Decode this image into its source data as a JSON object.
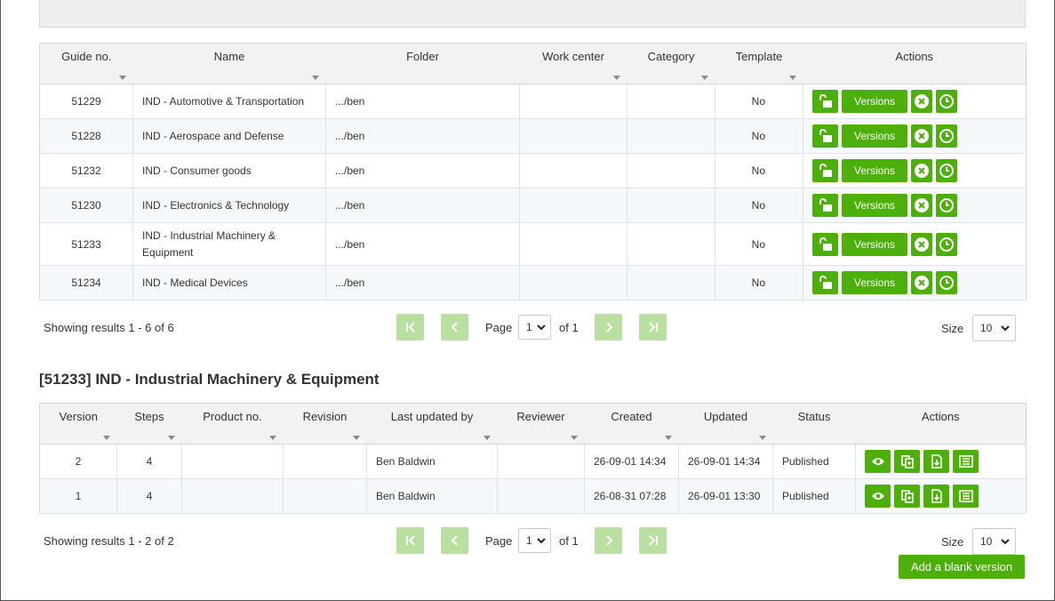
{
  "guides": {
    "columns": [
      "Guide no.",
      "Name",
      "Folder",
      "Work center",
      "Category",
      "Template",
      "Actions"
    ],
    "rows": [
      {
        "guide_no": "51229",
        "name": "IND - Automotive & Transportation",
        "folder": ".../ben",
        "work_center": "",
        "category": "",
        "template": "No"
      },
      {
        "guide_no": "51228",
        "name": "IND - Aerospace and Defense",
        "folder": ".../ben",
        "work_center": "",
        "category": "",
        "template": "No"
      },
      {
        "guide_no": "51232",
        "name": "IND - Consumer goods",
        "folder": ".../ben",
        "work_center": "",
        "category": "",
        "template": "No"
      },
      {
        "guide_no": "51230",
        "name": "IND - Electronics & Technology",
        "folder": ".../ben",
        "work_center": "",
        "category": "",
        "template": "No"
      },
      {
        "guide_no": "51233",
        "name": "IND - Industrial Machinery & Equipment",
        "folder": ".../ben",
        "work_center": "",
        "category": "",
        "template": "No"
      },
      {
        "guide_no": "51234",
        "name": "IND - Medical Devices",
        "folder": ".../ben",
        "work_center": "",
        "category": "",
        "template": "No"
      }
    ],
    "versions_label": "Versions",
    "pager": {
      "showing": "Showing results 1 - 6 of 6",
      "page_label": "Page",
      "page_value": "1",
      "of_label": "of 1",
      "size_label": "Size",
      "size_value": "10"
    }
  },
  "detail": {
    "title": "[51233] IND - Industrial Machinery & Equipment",
    "columns": [
      "Version",
      "Steps",
      "Product no.",
      "Revision",
      "Last updated by",
      "Reviewer",
      "Created",
      "Updated",
      "Status",
      "Actions"
    ],
    "rows": [
      {
        "version": "2",
        "steps": "4",
        "product_no": "",
        "revision": "",
        "last_updated_by": "Ben Baldwin",
        "reviewer": "",
        "created": "26-09-01 14:34",
        "updated": "26-09-01 14:34",
        "status": "Published"
      },
      {
        "version": "1",
        "steps": "4",
        "product_no": "",
        "revision": "",
        "last_updated_by": "Ben Baldwin",
        "reviewer": "",
        "created": "26-08-31 07:28",
        "updated": "26-09-01 13:30",
        "status": "Published"
      }
    ],
    "pager": {
      "showing": "Showing results 1 - 2 of 2",
      "page_label": "Page",
      "page_value": "1",
      "of_label": "of 1",
      "size_label": "Size",
      "size_value": "10"
    },
    "add_blank_label": "Add a blank version"
  },
  "colors": {
    "accent": "#4caf0a",
    "accent_disabled": "#b9e0a1",
    "header_bg": "#f2f2f2"
  },
  "icons": [
    "unlock-icon",
    "close-circle-icon",
    "clock-icon",
    "eye-icon",
    "copy-icon",
    "download-icon",
    "report-icon",
    "first-page-icon",
    "prev-page-icon",
    "next-page-icon",
    "last-page-icon",
    "chevron-down-icon"
  ]
}
